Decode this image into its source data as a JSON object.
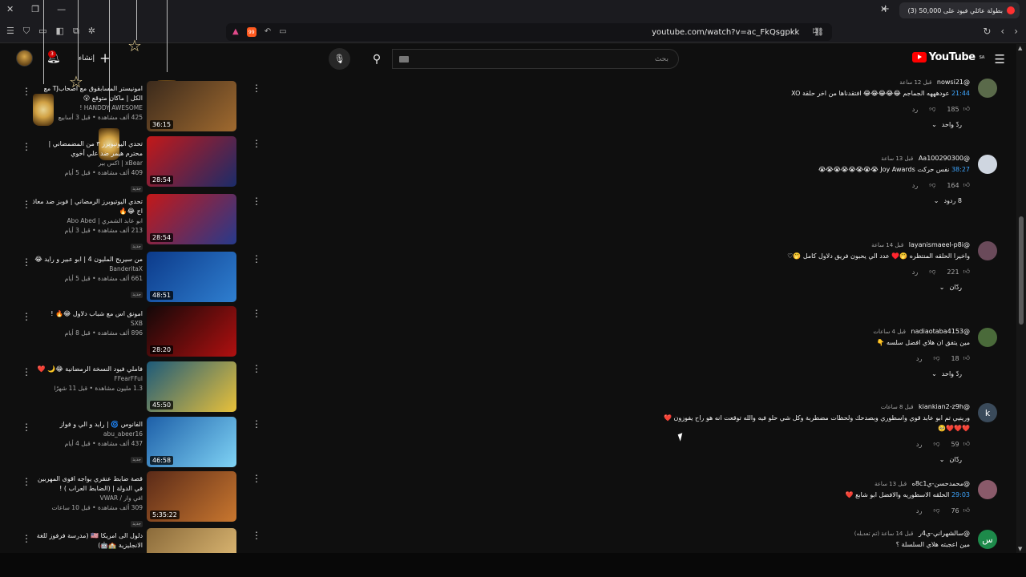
{
  "browser": {
    "tab_title": "(3) بطولة عائلي فيود على 50,000",
    "url": "youtube.com/watch?v=ac_FkQsgpkk"
  },
  "youtube": {
    "logo": "YouTube",
    "logo_region": "SA",
    "search_placeholder": "بحث",
    "create_label": "إنشاء",
    "notification_count": "3"
  },
  "videos": [
    {
      "title": "امونيستر المسابقوق مع اصحابTJ مع الكل | ماكان متوقع 😮",
      "channel": "HANDDY AWESOME !",
      "meta": "425 ألف مشاهدة • قبل 3 أسابيع",
      "duration": "36:15",
      "is_new": "",
      "c1": "#3b2a1c",
      "c2": "#a06a2f"
    },
    {
      "title": "تحدي اليوتيوبرز ٣ من المضمضاني | محترم هيمر ضد علي أخوي",
      "channel": "xBear | اكس بير",
      "meta": "409 ألف مشاهدة • قبل 5 أيام",
      "duration": "28:54",
      "is_new": "جديد",
      "c1": "#c41818",
      "c2": "#1a2c6a"
    },
    {
      "title": "تحدي اليوتيوبرز الرمضاني | فوبز ضد معاذ اج 😂🔥",
      "channel": "ابو عابد الشمري | Abo Abed",
      "meta": "213 ألف مشاهدة • قبل 3 أيام",
      "duration": "28:54",
      "is_new": "جديد",
      "c1": "#c41818",
      "c2": "#263a8c"
    },
    {
      "title": "من سيربح المليون 4 | ابو عبير و رايد 😂",
      "channel": "BanderitaX",
      "meta": "661 ألف مشاهدة • قبل 5 أيام",
      "duration": "48:51",
      "is_new": "جديد",
      "c1": "#0c3a8a",
      "c2": "#2f7fd0"
    },
    {
      "title": "امونق اس مع شباب دلاول 😂🔥 !",
      "channel": "SXB",
      "meta": "896 ألف مشاهدة • قبل 8 أيام",
      "duration": "28:20",
      "is_new": "",
      "c1": "#120808",
      "c2": "#b01010"
    },
    {
      "title": "فاملي فيود النسخة الرمضانية 😂🌙 ❤️",
      "channel": "FFearFFul",
      "meta": "1.3 مليون مشاهدة • قبل 11 شهرًا",
      "duration": "45:50",
      "is_new": "",
      "c1": "#1c5a7a",
      "c2": "#e9c13a"
    },
    {
      "title": "الفانوس 🌀 | رايد و الي و فواز",
      "channel": "abu_abeer16",
      "meta": "437 ألف مشاهدة • قبل 4 أيام",
      "duration": "46:58",
      "is_new": "جديد",
      "c1": "#1d5fa8",
      "c2": "#7fd3f5"
    },
    {
      "title": "قصة ضابط عنقري يواجه اقوى المهربين في الدولة | (الضابط العراب ) !",
      "channel": "افي وار / VWAR",
      "meta": "309 ألف مشاهدة • قبل 10 ساعات",
      "duration": "5:35:22",
      "is_new": "جديد",
      "c1": "#5a2a18",
      "c2": "#c9772f"
    },
    {
      "title": "دلول الى امريكا 🇺🇸 (مدرسة فرفوز للغة الانجليزية 🏫🤖)",
      "channel": "",
      "meta": "",
      "duration": "",
      "is_new": "",
      "c1": "#8a6a3a",
      "c2": "#e7c27a"
    }
  ],
  "comments": [
    {
      "author": "@nowsi21",
      "when": "قبل 12 ساعة",
      "timestamp": "21:44",
      "text": "عودهههه الجماجم 😂😂😂😂😂 افتقدناها من اخر حلقة XO",
      "likes": "185",
      "reply": "رد",
      "replies": "ردّ واحد",
      "avatar_color": "#5a6a4a",
      "avatar_letter": ""
    },
    {
      "author": "@Aa100290300",
      "when": "قبل 13 ساعة",
      "timestamp": "38:27",
      "text": "نفس حركت Joy Awards 😭😭😭😭😭😭😭😭",
      "likes": "164",
      "reply": "رد",
      "replies": "8 ردود",
      "avatar_color": "#cfd6e0",
      "avatar_letter": ""
    },
    {
      "author": "@layanismaeel-p8i",
      "when": "قبل 14 ساعة",
      "timestamp": "",
      "text": "واخيرا الحلقه المنتظره 🤭♥️ عدد الي يحبون فريق دلاول كامل 🤭♡",
      "likes": "221",
      "reply": "رد",
      "replies": "ردّان",
      "avatar_color": "#6a4a5a",
      "avatar_letter": ""
    },
    {
      "author": "@nadiaotaba4153",
      "when": "قبل 4 ساعات",
      "timestamp": "",
      "text": "مين يتفق ان هلاي افضل سلسه 👇",
      "likes": "18",
      "reply": "رد",
      "replies": "ردّ واحد",
      "avatar_color": "#4a6a3a",
      "avatar_letter": ""
    },
    {
      "author": "@kiankian2-z9h",
      "when": "قبل 8 ساعات",
      "timestamp": "",
      "text": "ورينيي تم ابو عابد قوي واسطوري وبصدحك ولحظات مضطربة وكل شي حلو فيه والله توقعت انه هو راح يفوزون ❤️❤️❤️❤️🥺",
      "likes": "59",
      "reply": "رد",
      "replies": "ردّان",
      "avatar_color": "#3a4a5a",
      "avatar_letter": "k"
    },
    {
      "author": "@محمدحسن-ي8c1ه",
      "when": "قبل 13 ساعة",
      "timestamp": "29:03",
      "text": "الحلقه الاسطوريه والافضل ابو شابع ❤️",
      "likes": "76",
      "reply": "رد",
      "replies": "",
      "avatar_color": "#8a5a6a",
      "avatar_letter": ""
    },
    {
      "author": "@سالشهراني-ي4ر",
      "when": "قبل 14 ساعة (تم تعديله)",
      "timestamp": "",
      "text": "مين اعجبته هلاي السلسلة ؟",
      "likes": "",
      "reply": "",
      "replies": "",
      "avatar_color": "#1d8a4a",
      "avatar_letter": "س"
    }
  ]
}
